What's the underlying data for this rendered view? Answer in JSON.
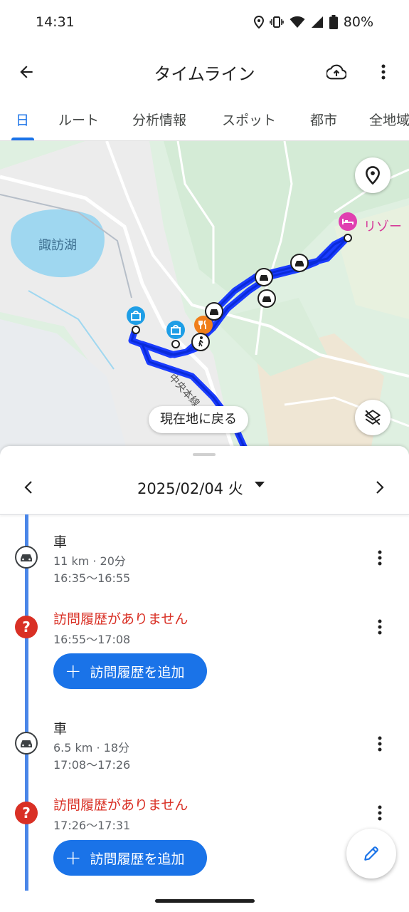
{
  "status_bar": {
    "time": "14:31",
    "battery": "80%"
  },
  "app_bar": {
    "title": "タイムライン"
  },
  "tabs": [
    {
      "label": "日"
    },
    {
      "label": "ルート"
    },
    {
      "label": "分析情報"
    },
    {
      "label": "スポット"
    },
    {
      "label": "都市"
    },
    {
      "label": "全地域"
    }
  ],
  "map": {
    "lake_label": "諏訪湖",
    "resort_label": "リゾー",
    "road_label": "中央本線",
    "recenter_label": "現在地に戻る",
    "route_color": "#1a3cff"
  },
  "date_nav": {
    "date": "2025/02/04 火"
  },
  "timeline": [
    {
      "type": "drive",
      "title": "車",
      "detail": "11 km · 20分",
      "time": "16:35〜16:55"
    },
    {
      "type": "unknown",
      "title": "訪問履歴がありません",
      "time": "16:55〜17:08",
      "button": "訪問履歴を追加"
    },
    {
      "type": "drive",
      "title": "車",
      "detail": "6.5 km · 18分",
      "time": "17:08〜17:26"
    },
    {
      "type": "unknown",
      "title": "訪問履歴がありません",
      "time": "17:26〜17:31",
      "button": "訪問履歴を追加"
    }
  ],
  "colors": {
    "accent": "#1a73e8",
    "warning": "#d93025",
    "timeline": "#4a86e8"
  }
}
